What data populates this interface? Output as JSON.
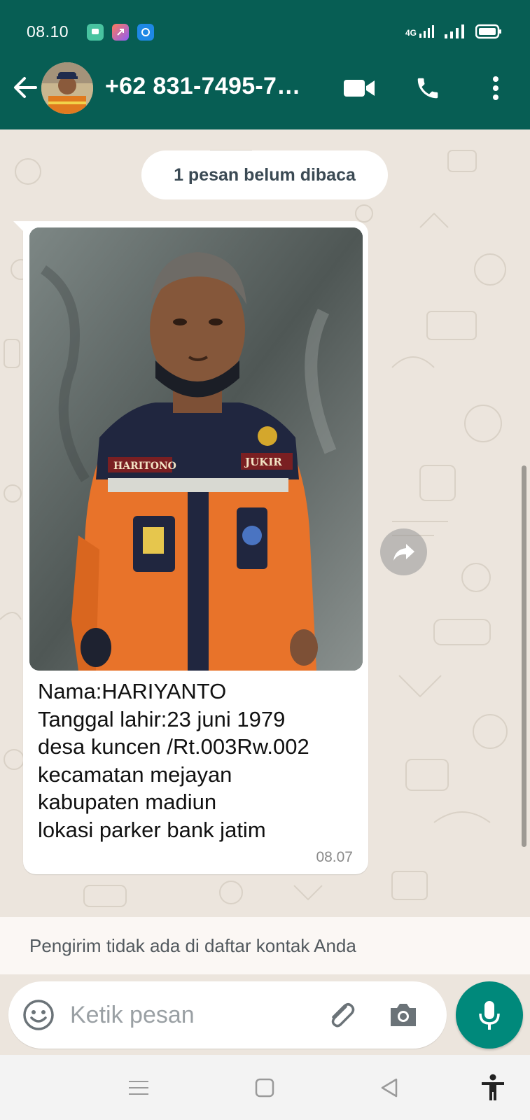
{
  "status_bar": {
    "time": "08.10",
    "network_label": "4G",
    "app_icons": [
      "chat-bubble-icon",
      "shortcut-icon",
      "app-circle-icon"
    ],
    "app_colors": [
      "#48c3a0",
      "#c25bd0",
      "#1e88e5"
    ]
  },
  "header": {
    "contact": "+62 831-7495-7…",
    "back_icon": "arrow-left-icon",
    "video_icon": "video-camera-icon",
    "call_icon": "phone-icon",
    "menu_icon": "more-vert-icon"
  },
  "chat": {
    "unread_banner": "1 pesan belum dibaca",
    "message": {
      "photo_labels": {
        "left_tag": "HARITONO",
        "right_tag": "JUKIR"
      },
      "caption_lines": [
        "Nama:HARIYANTO",
        "Tanggal lahir:23 juni 1979",
        "desa kuncen /Rt.003Rw.002",
        "kecamatan mejayan",
        "kabupaten madiun",
        "lokasi parker bank jatim"
      ],
      "time": "08.07"
    },
    "forward_icon": "forward-arrow-icon"
  },
  "notice": {
    "text": "Pengirim tidak ada di daftar kontak Anda"
  },
  "composer": {
    "placeholder": "Ketik pesan",
    "value": "",
    "emoji_icon": "emoji-icon",
    "attach_icon": "paperclip-icon",
    "camera_icon": "camera-icon",
    "mic_icon": "microphone-icon"
  },
  "nav": {
    "menu_icon": "recent-apps-icon",
    "home_icon": "home-icon",
    "back_icon": "back-triangle-icon",
    "accessibility_icon": "accessibility-icon"
  },
  "colors": {
    "header": "#075E54",
    "accent": "#00897B",
    "chat_bg": "#ECE5DD",
    "bubble": "#FFFFFF",
    "uniform_orange": "#E8732A",
    "uniform_navy": "#20263F"
  }
}
